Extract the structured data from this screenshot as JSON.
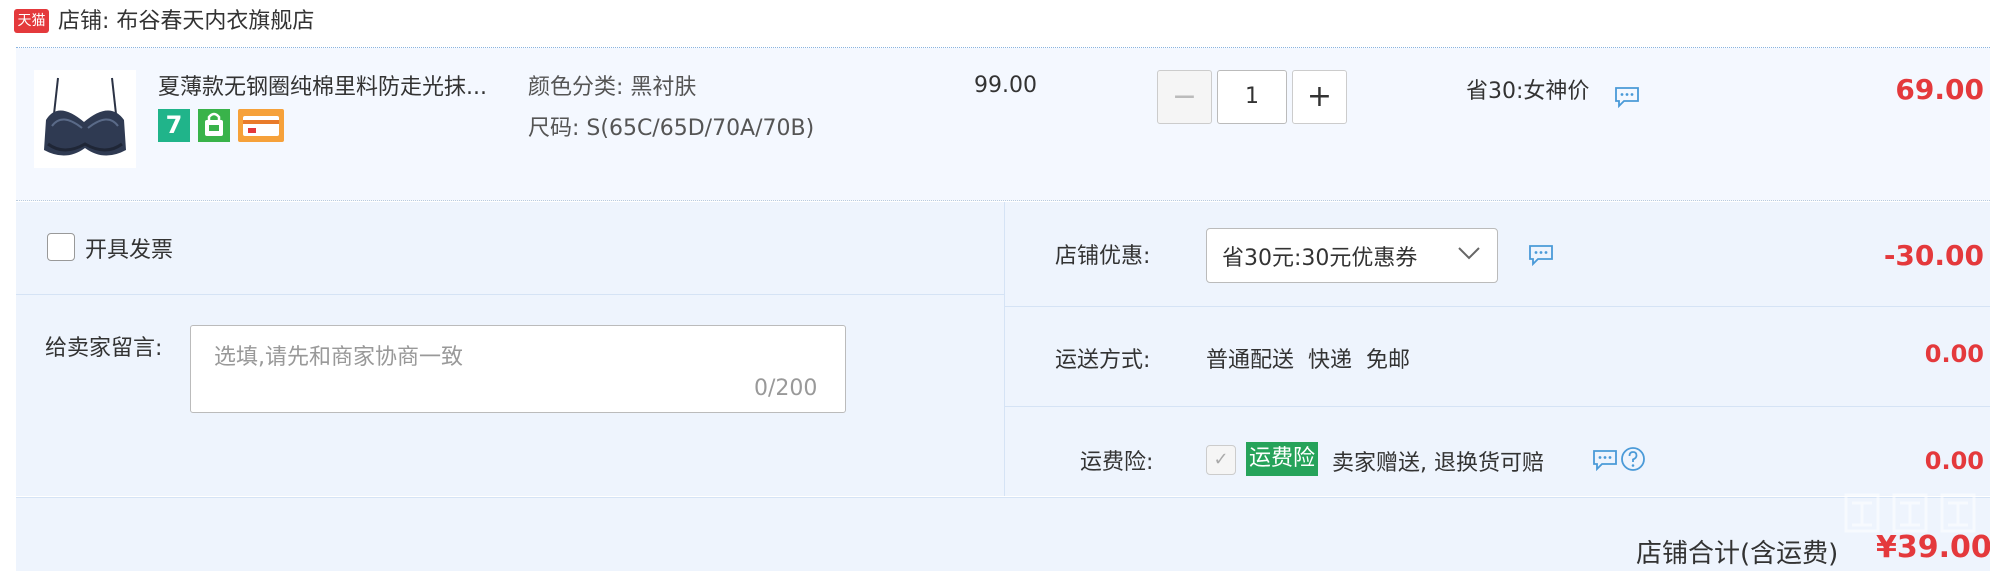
{
  "shop": {
    "logo_text": "天猫",
    "title": "店铺: 布谷春天内衣旗舰店"
  },
  "item": {
    "title": "夏薄款无钢圈纯棉里料防走光抹...",
    "badge_seven": "7",
    "color_label": "颜色分类: 黑衬肤",
    "size_label": "尺码: S(65C/65D/70A/70B)",
    "price": "99.00",
    "qty_minus": "−",
    "quantity": "1",
    "qty_plus": "+",
    "promo": "省30:女神价",
    "subtotal": "69.00"
  },
  "invoice": {
    "label": "开具发票"
  },
  "message": {
    "label": "给卖家留言:",
    "placeholder": "选填,请先和商家协商一致",
    "count": "0/200"
  },
  "coupon": {
    "label": "店铺优惠:",
    "value": "省30元:30元优惠券",
    "amount": "-30.00"
  },
  "shipping": {
    "label": "运送方式:",
    "value": "普通配送  快递  免邮",
    "amount": "0.00"
  },
  "insurance": {
    "label": "运费险:",
    "tag": "运费险",
    "desc": "卖家赠送, 退换货可赔",
    "amount": "0.00"
  },
  "total": {
    "label": "店铺合计(含运费)",
    "value": "¥39.00"
  },
  "colors": {
    "accent_red": "#e4393c",
    "panel_bg": "#eef4fd",
    "item_bg": "#f4f8ff",
    "insurance_green": "#26a35a"
  }
}
